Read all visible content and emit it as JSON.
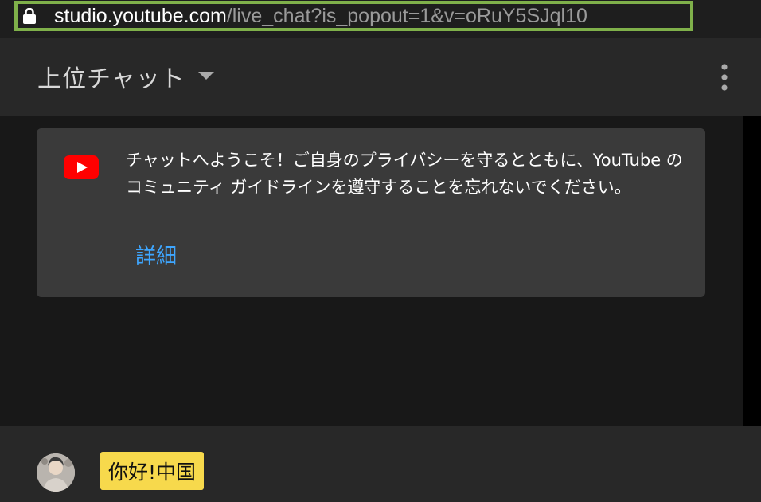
{
  "browser": {
    "url_host": "studio.youtube.com",
    "url_path": "/live_chat?is_popout=1&v=oRuY5SJql10",
    "lock_icon": "lock-icon"
  },
  "chat_header": {
    "mode_label": "上位チャット",
    "caret_icon": "caret-down-icon",
    "menu_icon": "more-vertical-icon"
  },
  "welcome": {
    "icon": "youtube-icon",
    "text": "チャットへようこそ！ご自身のプライバシーを守るとともに、YouTube のコミュニティ ガイドラインを遵守することを忘れないでください。",
    "link_label": "詳細"
  },
  "footer": {
    "avatar_icon": "user-avatar",
    "chip_text": "你好!中国"
  },
  "colors": {
    "accent_link": "#3ea6ff",
    "url_highlight_border": "#7fb04a",
    "youtube_red": "#ff0000",
    "chip_background": "#f7d94c"
  }
}
